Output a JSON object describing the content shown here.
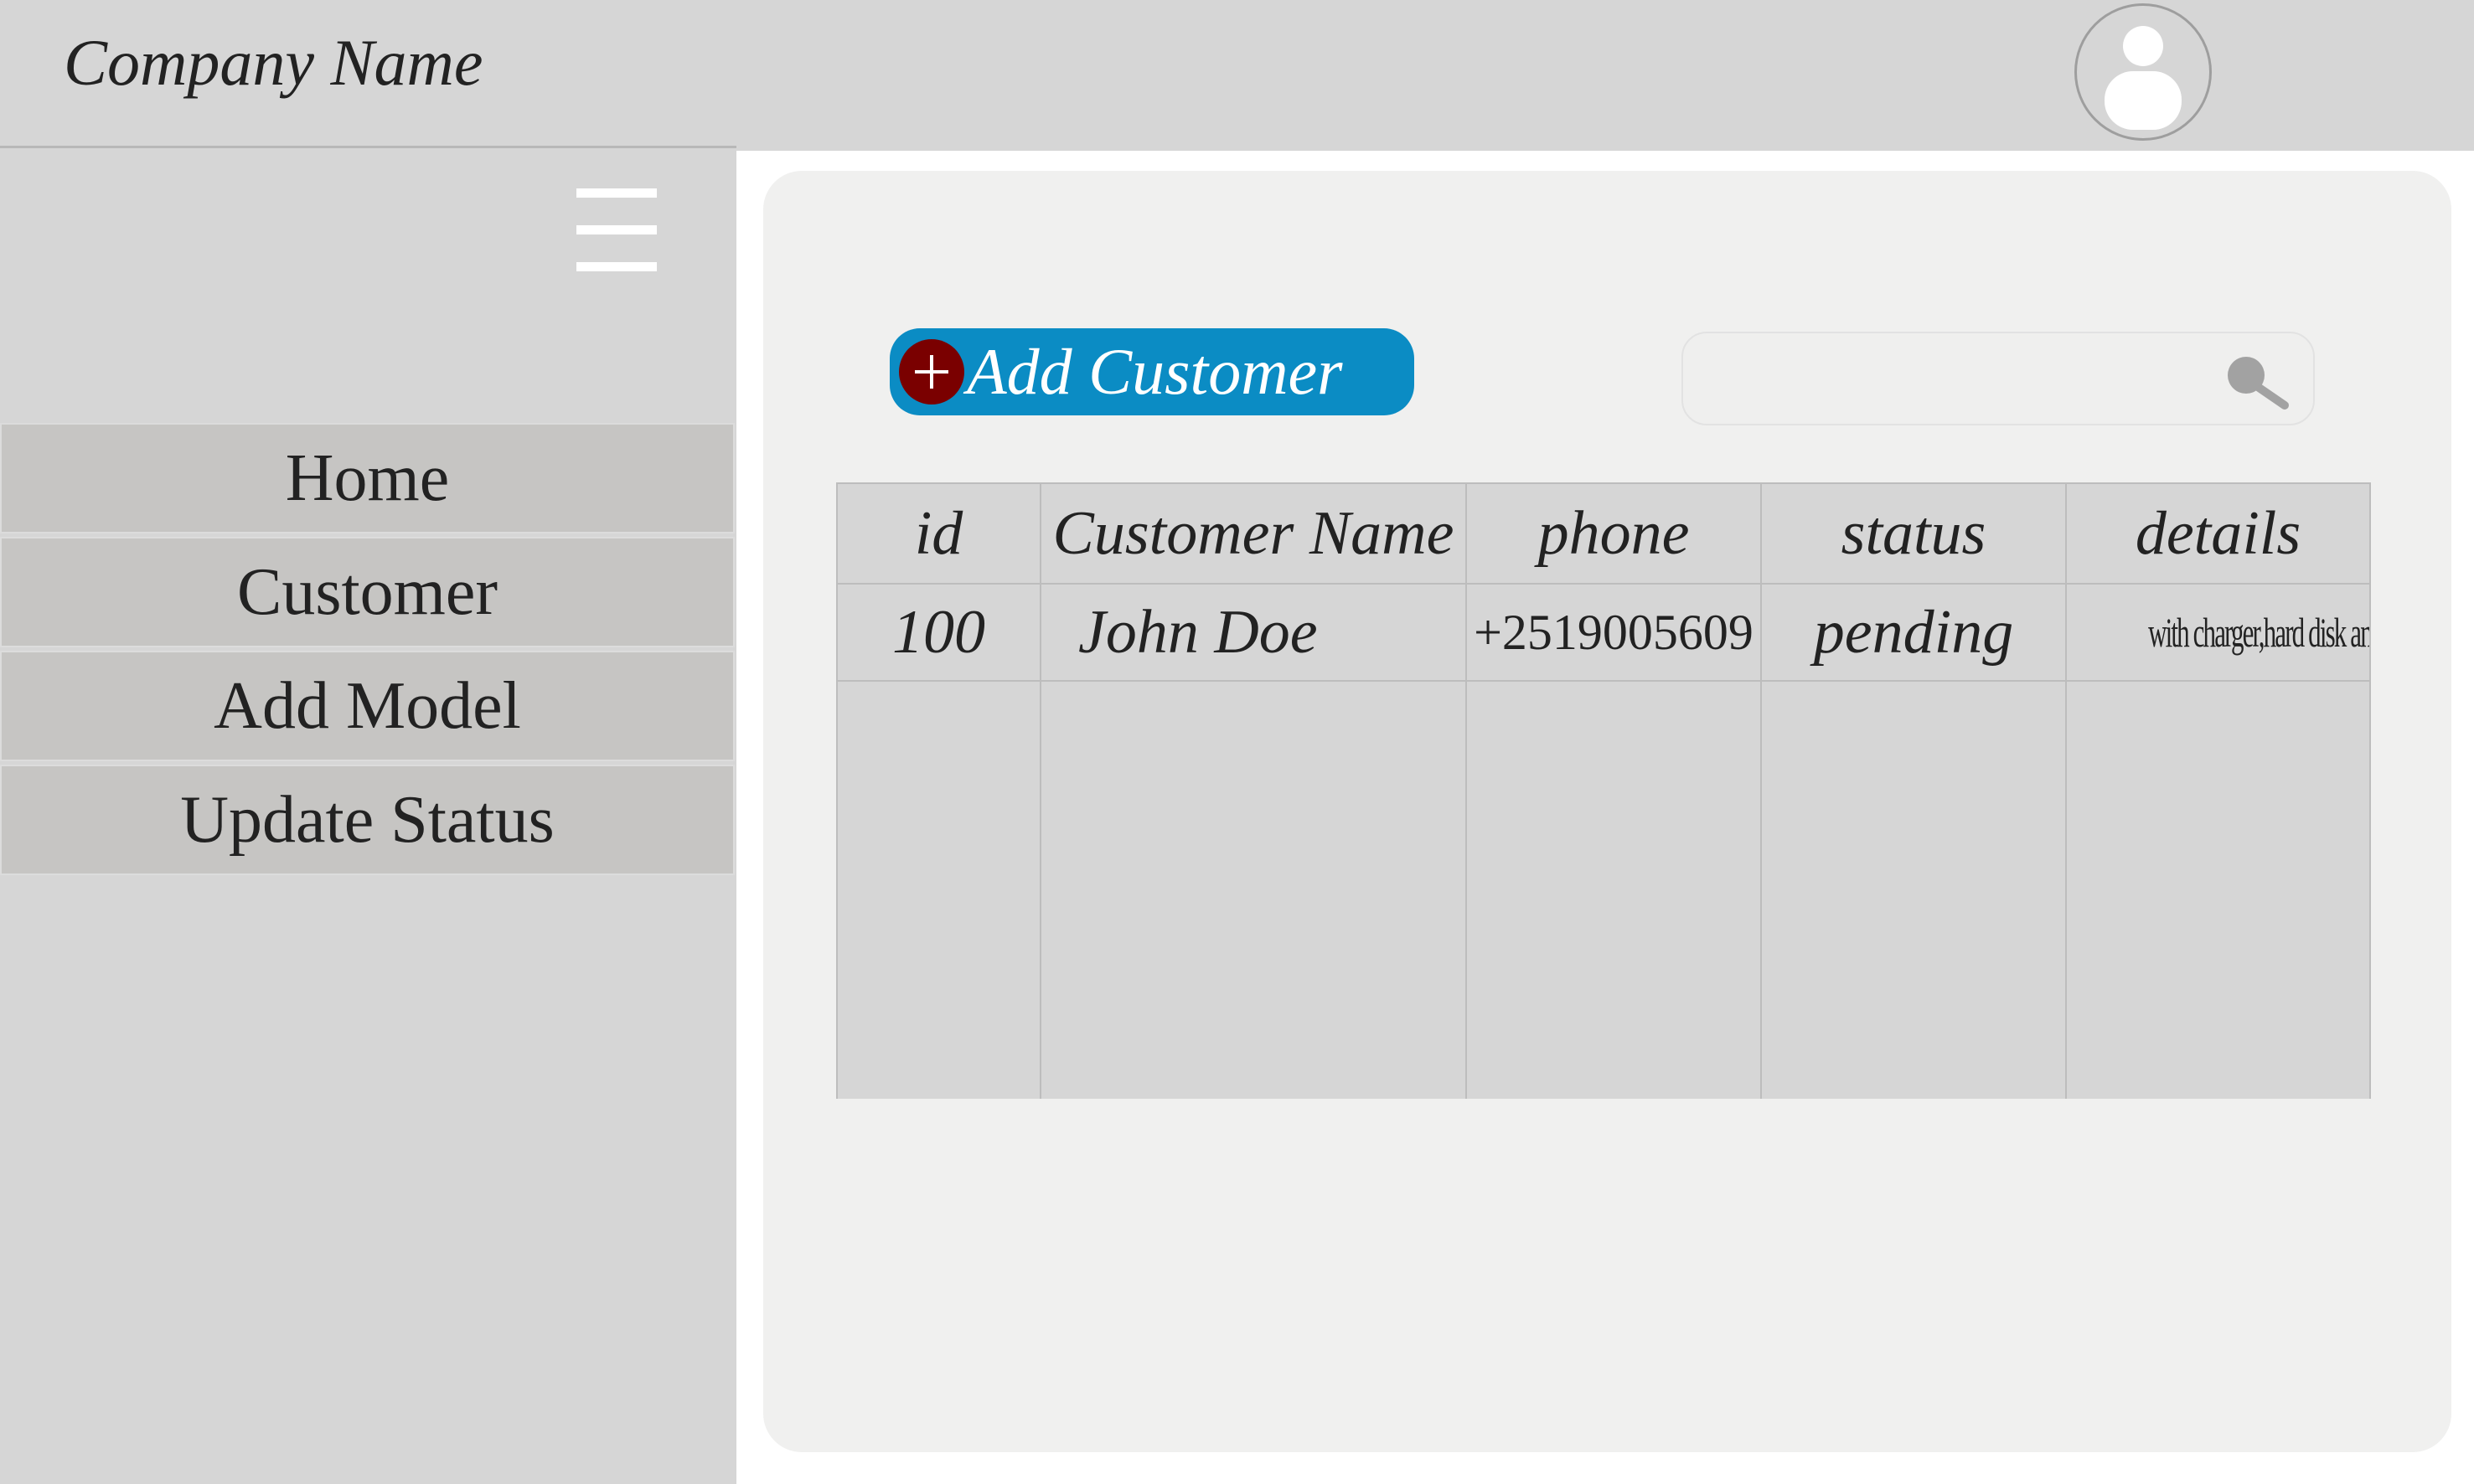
{
  "header": {
    "company_name": "Company Name"
  },
  "sidebar": {
    "items": [
      {
        "label": "Home"
      },
      {
        "label": "Customer"
      },
      {
        "label": "Add Model"
      },
      {
        "label": "Update Status"
      }
    ]
  },
  "main": {
    "add_customer_label": "Add Customer",
    "search": {
      "value": "",
      "placeholder": ""
    },
    "table": {
      "columns": [
        "id",
        "Customer Name",
        "phone",
        "status",
        "details"
      ],
      "rows": [
        {
          "id": "100",
          "name": "John Doe",
          "phone": "+2519005609",
          "status": "pending",
          "details": "with charger,hard disk and etc"
        }
      ]
    }
  },
  "colors": {
    "header_bg": "#d6d6d6",
    "sidebar_bg": "#d6d6d6",
    "nav_item_bg": "#c6c5c3",
    "panel_bg": "#f0f0ef",
    "accent_button": "#0b8cc4",
    "plus_icon": "#7a0000"
  },
  "icons": {
    "avatar": "user-avatar-icon",
    "menu": "hamburger-menu-icon",
    "add": "plus-circle-icon",
    "search": "search-icon"
  }
}
